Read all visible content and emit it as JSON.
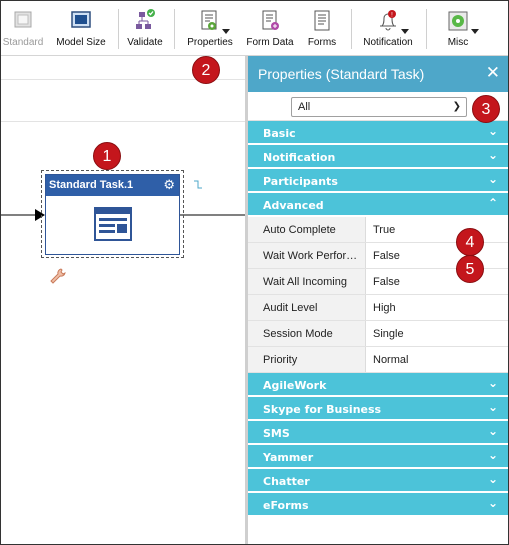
{
  "toolbar": {
    "items": [
      {
        "label": "Standard",
        "icon": "standard-layout-icon",
        "disabled": true
      },
      {
        "label": "Model Size",
        "icon": "model-size-icon"
      },
      {
        "label": "Validate",
        "icon": "validate-icon"
      },
      {
        "label": "Properties",
        "icon": "properties-icon"
      },
      {
        "label": "Form Data",
        "icon": "form-data-icon"
      },
      {
        "label": "Forms",
        "icon": "forms-icon"
      },
      {
        "label": "Notification",
        "icon": "notification-bell-icon"
      },
      {
        "label": "Misc",
        "icon": "misc-icon"
      }
    ]
  },
  "badges": [
    "1",
    "2",
    "3",
    "4",
    "5"
  ],
  "canvas": {
    "task_title": "Standard Task.1"
  },
  "panel": {
    "title": "Properties (Standard Task)",
    "close_glyph": "✕",
    "filter_value": "All",
    "sections_before": [
      "Basic",
      "Notification",
      "Participants"
    ],
    "expanded_section": "Advanced",
    "rows": [
      {
        "key": "Auto Complete",
        "value": "True"
      },
      {
        "key": "Wait Work Perfor…",
        "value": "False"
      },
      {
        "key": "Wait All Incoming",
        "value": "False"
      },
      {
        "key": "Audit Level",
        "value": "High"
      },
      {
        "key": "Session Mode",
        "value": "Single"
      },
      {
        "key": "Priority",
        "value": "Normal"
      }
    ],
    "sections_after": [
      "AgileWork",
      "Skype for Business",
      "SMS",
      "Yammer",
      "Chatter",
      "eForms"
    ]
  },
  "colors": {
    "section_bg": "#4cc3d9",
    "panel_header_bg": "#4ea7c9",
    "task_header_bg": "#2f5fa8",
    "badge": "#c4161c"
  }
}
